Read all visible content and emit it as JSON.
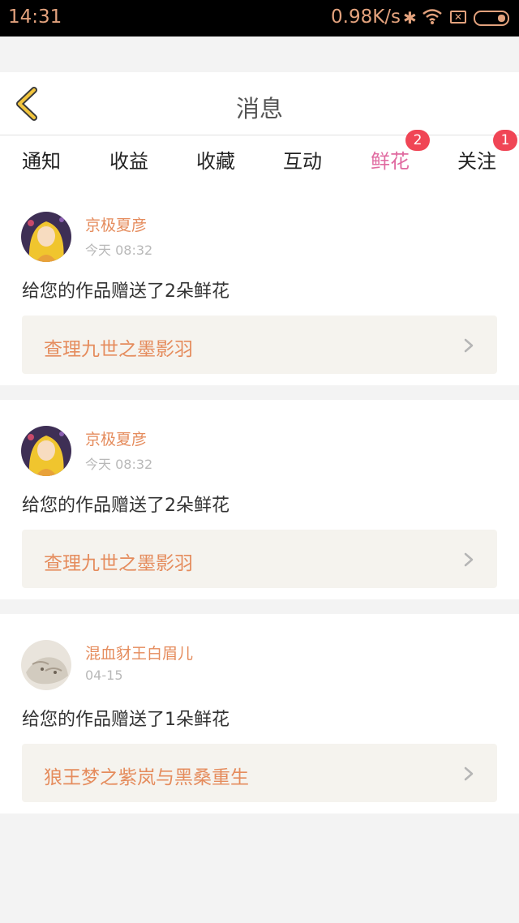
{
  "status_bar": {
    "time": "14:31",
    "net_speed": "0.98K/s",
    "icons": [
      "bluetooth-icon",
      "wifi-icon",
      "sim-disabled-icon",
      "battery-icon"
    ],
    "accent": "#e3a27d"
  },
  "header": {
    "title": "消息",
    "back_icon": "chevron-left-icon",
    "back_color": "#f2c53d"
  },
  "tabs": [
    {
      "label": "通知",
      "active": false
    },
    {
      "label": "收益",
      "active": false
    },
    {
      "label": "收藏",
      "active": false
    },
    {
      "label": "互动",
      "active": false
    },
    {
      "label": "鲜花",
      "active": true,
      "badge": "2"
    },
    {
      "label": "关注",
      "active": false,
      "badge": "1"
    }
  ],
  "colors": {
    "active_tab": "#e06aa0",
    "badge": "#f04555",
    "username": "#e58c5d",
    "work_title": "#e58c5d",
    "work_bg": "#f5f3ee"
  },
  "messages": [
    {
      "user": "京极夏彦",
      "time": "今天 08:32",
      "text": "给您的作品赠送了2朵鲜花",
      "work_title": "查理九世之墨影羽"
    },
    {
      "user": "京极夏彦",
      "time": "今天 08:32",
      "text": "给您的作品赠送了2朵鲜花",
      "work_title": "查理九世之墨影羽"
    },
    {
      "user": "混血豺王白眉儿",
      "time": "04-15",
      "text": "给您的作品赠送了1朵鲜花",
      "work_title": "狼王梦之紫岚与黑桑重生"
    }
  ]
}
